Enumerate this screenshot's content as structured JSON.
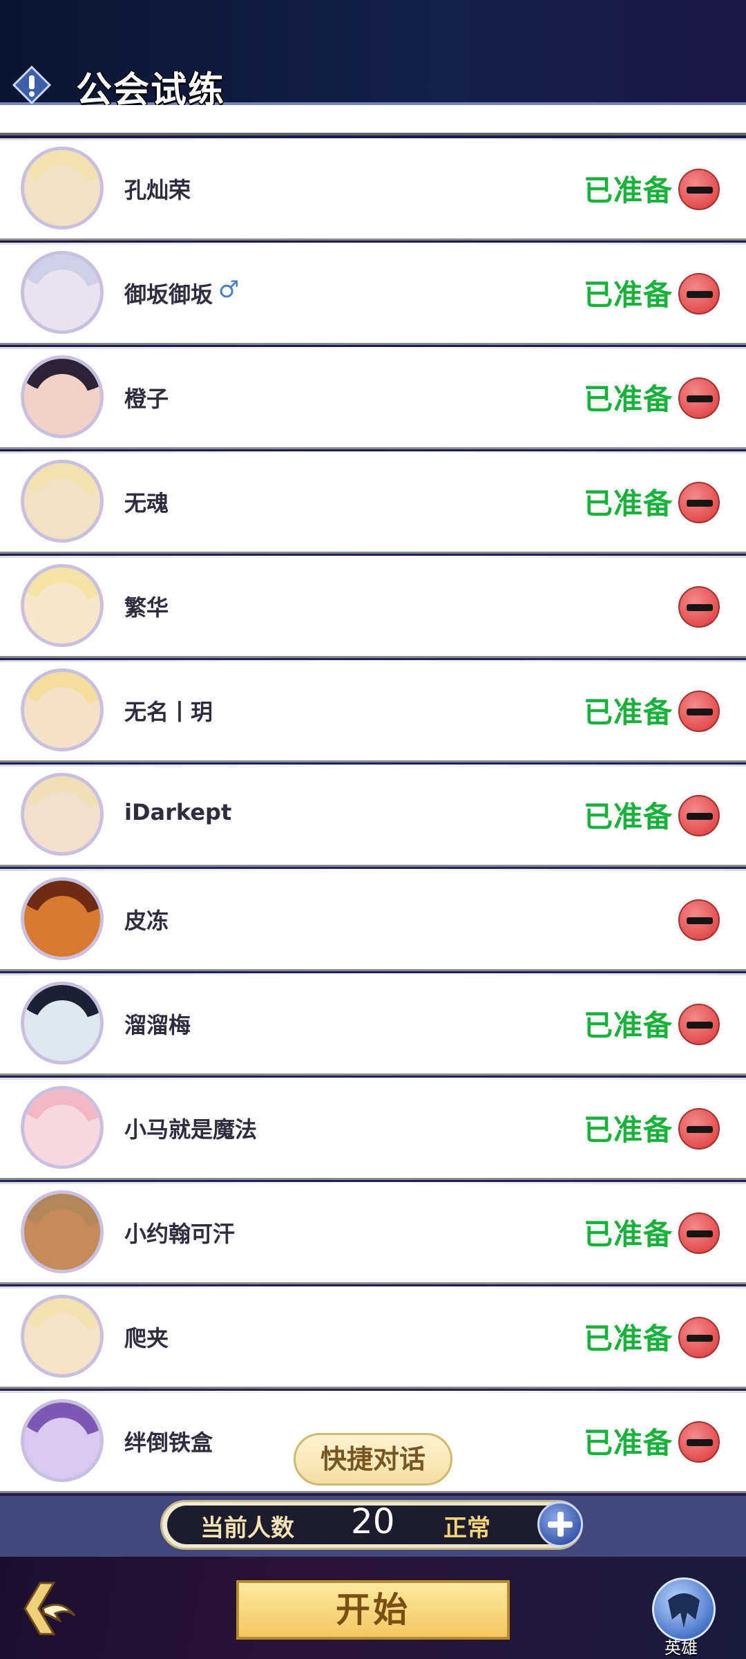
{
  "header": {
    "title": "公会试练",
    "info_icon": "exclamation-icon"
  },
  "members": [
    {
      "name": "孔灿荣",
      "ready": true,
      "avatar_color": "#efe3c4",
      "hair_color": "#f2e2b0"
    },
    {
      "name": "御坂御坂",
      "gender_icon": "♂",
      "ready": true,
      "avatar_color": "#e9e3ef",
      "hair_color": "#cfcfe6"
    },
    {
      "name": "橙子",
      "ready": true,
      "avatar_color": "#f0d2c8",
      "hair_color": "#2c2236"
    },
    {
      "name": "无魂",
      "ready": true,
      "avatar_color": "#efe3c4",
      "hair_color": "#f2e2b0"
    },
    {
      "name": "繁华",
      "ready": false,
      "avatar_color": "#f5e8c9",
      "hair_color": "#f3e4a6"
    },
    {
      "name": "无名丨玥",
      "ready": true,
      "avatar_color": "#f3e1c8",
      "hair_color": "#f4de9e"
    },
    {
      "name": "iDarkept",
      "ready": true,
      "avatar_color": "#f1dfcf",
      "hair_color": "#efe0b6"
    },
    {
      "name": "皮冻",
      "ready": false,
      "avatar_color": "#d9782f",
      "hair_color": "#6e2d12"
    },
    {
      "name": "溜溜梅",
      "ready": true,
      "avatar_color": "#dfe7ee",
      "hair_color": "#1b2033"
    },
    {
      "name": "小马就是魔法",
      "ready": true,
      "avatar_color": "#f6d8e0",
      "hair_color": "#f2b8c6"
    },
    {
      "name": "小约翰可汗",
      "ready": true,
      "avatar_color": "#c48a5a",
      "hair_color": "#b3875a"
    },
    {
      "name": "爬夹",
      "ready": true,
      "avatar_color": "#f3e3c8",
      "hair_color": "#f2e2b0"
    },
    {
      "name": "绊倒铁盒",
      "ready": true,
      "avatar_color": "#d9c8ef",
      "hair_color": "#7b59b5"
    }
  ],
  "ready_label": "已准备",
  "quick_chat_label": "快捷对话",
  "count_bar": {
    "label": "当前人数",
    "value": "20",
    "status": "正常"
  },
  "start_button": "开始",
  "hero_button": {
    "label": "英雄",
    "icon": "hero-helmet-icon"
  },
  "back_icon": "return-arrow-icon",
  "colors": {
    "ready_green": "#18b23a",
    "remove_red": "#e3504f"
  }
}
